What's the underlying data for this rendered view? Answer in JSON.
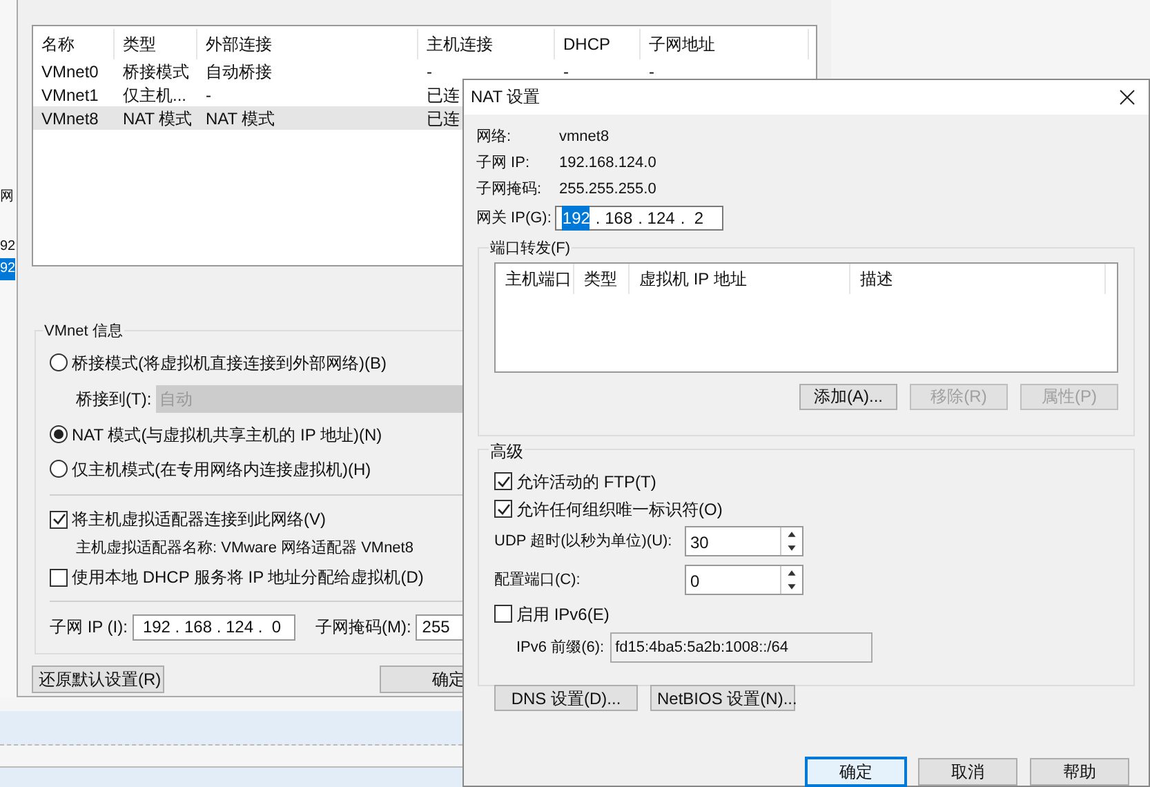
{
  "background_app": {
    "fragments": [
      {
        "text": "网",
        "selected": false
      },
      {
        "text": "92",
        "selected": false
      },
      {
        "text": "92",
        "selected": true
      }
    ]
  },
  "network_editor": {
    "table": {
      "columns": [
        "名称",
        "类型",
        "外部连接",
        "主机连接",
        "DHCP",
        "子网地址"
      ],
      "rows": [
        {
          "cells": [
            "VMnet0",
            "桥接模式",
            "自动桥接",
            "-",
            "-",
            "-"
          ],
          "selected": false
        },
        {
          "cells": [
            "VMnet1",
            "仅主机...",
            "-",
            "已连"
          ],
          "selected": false
        },
        {
          "cells": [
            "VMnet8",
            "NAT 模式",
            "NAT 模式",
            "已连"
          ],
          "selected": true
        }
      ]
    },
    "vmnet_info": {
      "title": "VMnet 信息",
      "items": [
        {
          "kind": "radio",
          "label": "桥接模式(将虚拟机直接连接到外部网络)(B)",
          "selected": false
        },
        {
          "kind": "select",
          "label": "桥接到(T):",
          "value": "自动",
          "disabled": true
        },
        {
          "kind": "radio",
          "label": "NAT 模式(与虚拟机共享主机的 IP 地址)(N)",
          "selected": true
        },
        {
          "kind": "radio",
          "label": "仅主机模式(在专用网络内连接虚拟机)(H)",
          "selected": false
        },
        {
          "kind": "separator"
        },
        {
          "kind": "checkbox",
          "label": "将主机虚拟适配器连接到此网络(V)",
          "checked": true
        },
        {
          "kind": "note",
          "label": "主机虚拟适配器名称: VMware 网络适配器 VMnet8"
        },
        {
          "kind": "checkbox",
          "label": "使用本地 DHCP 服务将 IP 地址分配给虚拟机(D)",
          "checked": false
        },
        {
          "kind": "separator"
        }
      ],
      "subnet_ip": {
        "label": "子网 IP (I):",
        "value": "192 . 168 . 124 .  0"
      },
      "subnet_mask": {
        "label": "子网掩码(M):",
        "value": "255"
      }
    },
    "buttons": [
      "还原默认设置(R)",
      "确定"
    ]
  },
  "nat_dialog": {
    "title": "NAT 设置",
    "info": [
      {
        "label": "网络:",
        "value": "vmnet8"
      },
      {
        "label": "子网 IP:",
        "value": "192.168.124.0"
      },
      {
        "label": "子网掩码:",
        "value": "255.255.255.0"
      }
    ],
    "gateway": {
      "label": "网关 IP(G):",
      "octets": [
        {
          "text": "192",
          "selected": true
        },
        {
          "text": ". 168",
          "selected": false
        },
        {
          "text": ". 124",
          "selected": false
        },
        {
          "text": ".  2",
          "selected": false
        }
      ]
    },
    "port_forwarding": {
      "title": "端口转发(F)",
      "columns": [
        "主机端口",
        "类型",
        "虚拟机 IP 地址",
        "描述"
      ],
      "buttons": [
        {
          "label": "添加(A)...",
          "disabled": false
        },
        {
          "label": "移除(R)",
          "disabled": true
        },
        {
          "label": "属性(P)",
          "disabled": true
        }
      ]
    },
    "advanced": {
      "title": "高级",
      "items": [
        {
          "kind": "checkbox",
          "label": "允许活动的 FTP(T)",
          "checked": true
        },
        {
          "kind": "checkbox",
          "label": "允许任何组织唯一标识符(O)",
          "checked": true
        },
        {
          "kind": "spinner",
          "label": "UDP 超时(以秒为单位)(U):",
          "value": "30"
        },
        {
          "kind": "spinner",
          "label": "配置端口(C):",
          "value": "0"
        },
        {
          "kind": "checkbox",
          "label": "启用 IPv6(E)",
          "checked": false
        },
        {
          "kind": "prefix",
          "label": "IPv6 前缀(6):",
          "value": "fd15:4ba5:5a2b:1008::/64"
        }
      ],
      "buttons": [
        "DNS 设置(D)...",
        "NetBIOS 设置(N)..."
      ]
    },
    "buttons": [
      {
        "label": "确定",
        "default": true
      },
      {
        "label": "取消",
        "default": false
      },
      {
        "label": "帮助",
        "default": false
      }
    ]
  }
}
